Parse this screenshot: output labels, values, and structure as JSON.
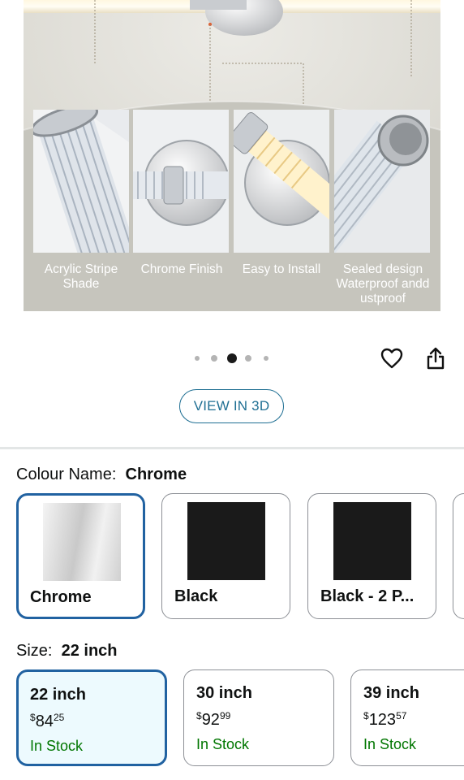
{
  "gallery": {
    "features": [
      {
        "label": "Acrylic Stripe Shade"
      },
      {
        "label": "Chrome Finish"
      },
      {
        "label": "Easy to Install"
      },
      {
        "label": "Sealed design Waterproof andd ustproof"
      }
    ],
    "dot_count": 5,
    "active_dot": 3
  },
  "actions": {
    "favorite_icon": "heart-icon",
    "share_icon": "share-icon",
    "view_3d_label": "VIEW IN 3D"
  },
  "colour": {
    "label": "Colour Name:",
    "selected": "Chrome",
    "options": [
      {
        "name": "Chrome",
        "swatch": "#d9d9d9"
      },
      {
        "name": "Black",
        "swatch": "#1a1a1a"
      },
      {
        "name": "Black - 2 P...",
        "swatch": "#1a1a1a"
      }
    ]
  },
  "size": {
    "label": "Size:",
    "selected": "22 inch",
    "options": [
      {
        "name": "22 inch",
        "currency": "$",
        "whole": "84",
        "fraction": "25",
        "stock": "In Stock"
      },
      {
        "name": "30 inch",
        "currency": "$",
        "whole": "92",
        "fraction": "99",
        "stock": "In Stock"
      },
      {
        "name": "39 inch",
        "currency": "$",
        "whole": "123",
        "fraction": "57",
        "stock": "In Stock"
      }
    ]
  },
  "colors": {
    "accent": "#2162a1",
    "link": "#1f6f93",
    "in_stock": "#007600",
    "selected_bg": "#edfafe"
  }
}
